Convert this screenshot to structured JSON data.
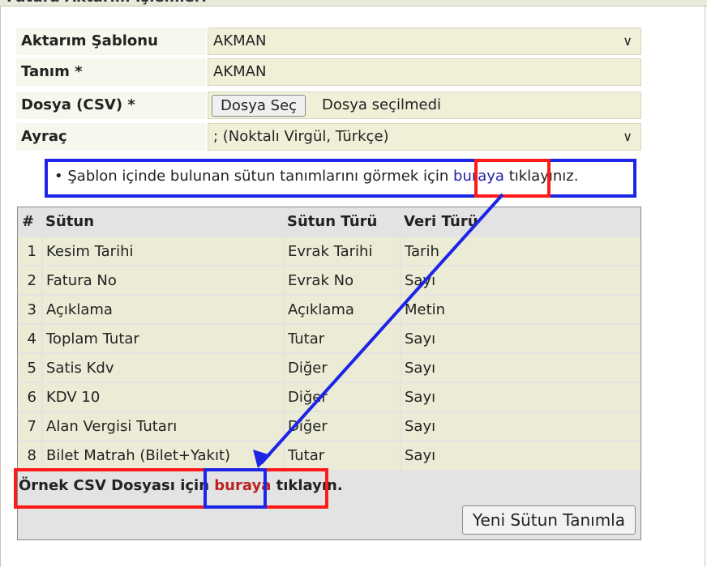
{
  "panel": {
    "title": "Fatura Aktarım İşlemleri"
  },
  "form": {
    "template_label": "Aktarım Şablonu",
    "template_value": "AKMAN",
    "definition_label": "Tanım *",
    "definition_value": "AKMAN",
    "file_label": "Dosya (CSV) *",
    "file_button": "Dosya Seç",
    "file_status": "Dosya seçilmedi",
    "separator_label": "Ayraç",
    "separator_value": "; (Noktalı Virgül, Türkçe)"
  },
  "info": {
    "bullet": "•",
    "text_before": "Şablon içinde bulunan sütun tanımlarını görmek için ",
    "link": "buraya",
    "text_after": " tıklayınız."
  },
  "table": {
    "headers": {
      "num": "#",
      "column": "Sütun",
      "column_type": "Sütun Türü",
      "data_type": "Veri Türü"
    },
    "rows": [
      {
        "num": "1",
        "column": "Kesim Tarihi",
        "column_type": "Evrak Tarihi",
        "data_type": "Tarih"
      },
      {
        "num": "2",
        "column": "Fatura No",
        "column_type": "Evrak No",
        "data_type": "Sayı"
      },
      {
        "num": "3",
        "column": "Açıklama",
        "column_type": "Açıklama",
        "data_type": "Metin"
      },
      {
        "num": "4",
        "column": "Toplam Tutar",
        "column_type": "Tutar",
        "data_type": "Sayı"
      },
      {
        "num": "5",
        "column": "Satis Kdv",
        "column_type": "Diğer",
        "data_type": "Sayı"
      },
      {
        "num": "6",
        "column": "KDV 10",
        "column_type": "Diğer",
        "data_type": "Sayı"
      },
      {
        "num": "7",
        "column": "Alan Vergisi Tutarı",
        "column_type": "Diğer",
        "data_type": "Sayı"
      },
      {
        "num": "8",
        "column": "Bilet Matrah (Bilet+Yakıt)",
        "column_type": "Tutar",
        "data_type": "Sayı"
      }
    ],
    "sample_before": "Örnek CSV Dosyası için ",
    "sample_link": "buraya",
    "sample_after": " tıklayın.",
    "new_column_button": "Yeni Sütun Tanımla"
  },
  "colors": {
    "annotation_blue": "#1c24e6",
    "annotation_red": "#ff1a1a",
    "link_blue": "#2222aa",
    "link_red": "#b22222"
  },
  "icons": {
    "select_arrow": "chevron-down-icon",
    "bullet": "bullet-icon",
    "arrow": "arrow-icon"
  }
}
